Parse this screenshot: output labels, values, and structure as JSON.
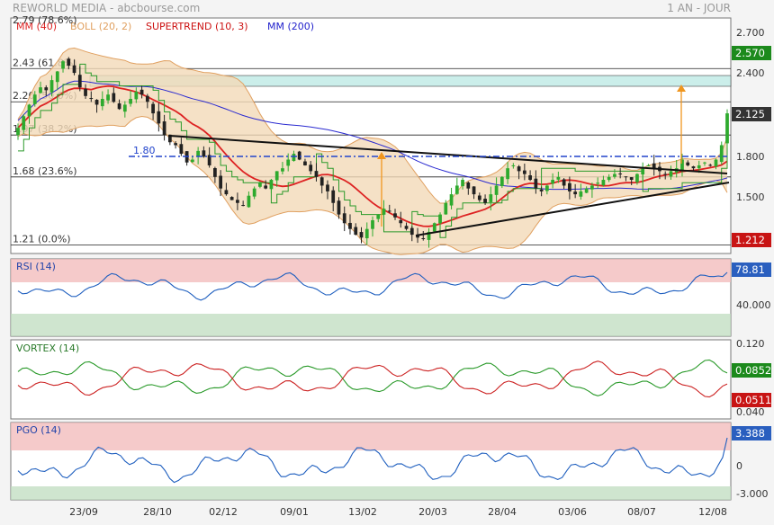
{
  "header": {
    "title": "REWORLD MEDIA - abcbourse.com",
    "period": "1 AN - JOUR"
  },
  "colors": {
    "ma40": "#dd2222",
    "bollinger": "#e0a060",
    "bollinger_fill": "#f3d9b8",
    "supertrend": "#2a9a2a",
    "ma200": "#2a2ad0",
    "candle_up": "#2eaa2e",
    "candle_down": "#222222",
    "trendline": "#111111",
    "level_180": "#2244cc",
    "arrow": "#f0961e",
    "rsi_line": "#1f5fbf",
    "vortex_plus": "#2a9a2a",
    "vortex_minus": "#cc2222",
    "badge_green": "#1c8a1c",
    "badge_red": "#c81414",
    "badge_blue": "#2a5fbf",
    "badge_dark": "#333333"
  },
  "legend": [
    {
      "label": "MM (40)",
      "color": "#dd2222"
    },
    {
      "label": "BOLL (20, 2)",
      "color": "#e0a060"
    },
    {
      "label": "SUPERTREND (10, 3)",
      "color": "#cc1111"
    },
    {
      "label": "MM (200)",
      "color": "#2222cc"
    }
  ],
  "price_axis": {
    "ticks": [
      "2.700",
      "2.400",
      "2.100",
      "1.800",
      "1.500"
    ]
  },
  "price_badges": {
    "supertrend": "2.570",
    "last": "2.125",
    "low": "1.212"
  },
  "fibonacci": [
    {
      "label": "2.43  (61.8%)",
      "value": 2.43
    },
    {
      "label": "2.20  (50.0%)",
      "value": 2.2
    },
    {
      "label": "1.97  (38.2%)",
      "value": 1.97
    },
    {
      "label": "1.68  (23.6%)",
      "value": 1.68
    },
    {
      "label": "1.21  (0.0%)",
      "value": 1.21
    }
  ],
  "fib_top_label": "2.79  (78.6%)",
  "level_label": "1.80",
  "x_labels": [
    "23/09",
    "28/10",
    "02/12",
    "09/01",
    "13/02",
    "20/03",
    "28/04",
    "03/06",
    "08/07",
    "12/08"
  ],
  "rsi": {
    "title": "RSI (14)",
    "value": "78.81",
    "tick": "40.000"
  },
  "vortex": {
    "title": "VORTEX (14)",
    "plus": "0.0852",
    "minus": "0.0511",
    "ticks": [
      "0.120",
      "0.040"
    ]
  },
  "pgo": {
    "title": "PGO (14)",
    "value": "3.388",
    "ticks": [
      "0",
      "-3.000"
    ]
  },
  "chart_data": {
    "type": "candlestick",
    "title": "REWORLD MEDIA",
    "ylim": [
      1.15,
      2.78
    ],
    "close": [
      2.02,
      2.1,
      2.18,
      2.25,
      2.3,
      2.28,
      2.35,
      2.41,
      2.48,
      2.45,
      2.4,
      2.3,
      2.24,
      2.22,
      2.18,
      2.22,
      2.25,
      2.2,
      2.15,
      2.18,
      2.22,
      2.27,
      2.25,
      2.2,
      2.12,
      2.05,
      1.97,
      1.92,
      1.9,
      1.84,
      1.78,
      1.8,
      1.86,
      1.82,
      1.76,
      1.68,
      1.6,
      1.56,
      1.52,
      1.5,
      1.48,
      1.55,
      1.6,
      1.64,
      1.6,
      1.66,
      1.72,
      1.74,
      1.8,
      1.84,
      1.8,
      1.76,
      1.72,
      1.68,
      1.62,
      1.58,
      1.5,
      1.42,
      1.36,
      1.32,
      1.28,
      1.26,
      1.32,
      1.38,
      1.42,
      1.46,
      1.44,
      1.4,
      1.36,
      1.32,
      1.28,
      1.26,
      1.25,
      1.3,
      1.36,
      1.42,
      1.5,
      1.56,
      1.62,
      1.66,
      1.6,
      1.56,
      1.52,
      1.5,
      1.56,
      1.62,
      1.68,
      1.74,
      1.76,
      1.72,
      1.7,
      1.66,
      1.6,
      1.58,
      1.62,
      1.66,
      1.68,
      1.62,
      1.58,
      1.56,
      1.58,
      1.6,
      1.62,
      1.64,
      1.66,
      1.68,
      1.7,
      1.7,
      1.68,
      1.66,
      1.7,
      1.74,
      1.76,
      1.74,
      1.72,
      1.7,
      1.72,
      1.74,
      1.8,
      1.76,
      1.74,
      1.76,
      1.78,
      1.76,
      1.8,
      1.9,
      2.12
    ]
  }
}
